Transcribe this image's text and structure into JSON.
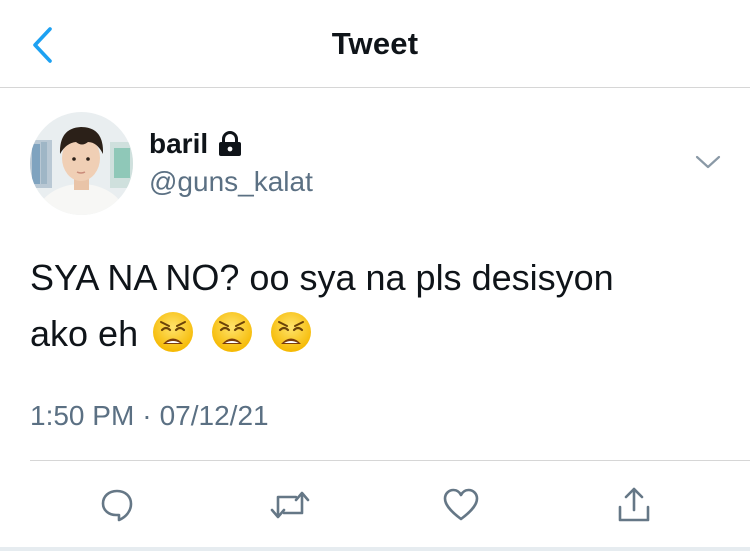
{
  "header": {
    "title": "Tweet",
    "back_icon": "chevron-left-icon"
  },
  "tweet": {
    "author": {
      "display_name": "baril",
      "handle": "@guns_kalat",
      "protected_icon": "lock-icon",
      "avatar": "profile-photo"
    },
    "text_line1": "SYA NA NO? oo sya na pls desisyon",
    "text_line2": "ako eh",
    "emojis": [
      "weary-face",
      "weary-face",
      "weary-face"
    ],
    "time": "1:50 PM",
    "separator": "·",
    "date": "07/12/21",
    "more_icon": "chevron-down-icon"
  },
  "actions": [
    {
      "name": "reply",
      "icon": "reply-icon"
    },
    {
      "name": "retweet",
      "icon": "retweet-icon"
    },
    {
      "name": "like",
      "icon": "heart-icon"
    },
    {
      "name": "share",
      "icon": "share-icon"
    }
  ],
  "colors": {
    "accent": "#1da1f2",
    "text_primary": "#0f1419",
    "text_secondary": "#5b7083",
    "divider": "#d6d6d6"
  }
}
